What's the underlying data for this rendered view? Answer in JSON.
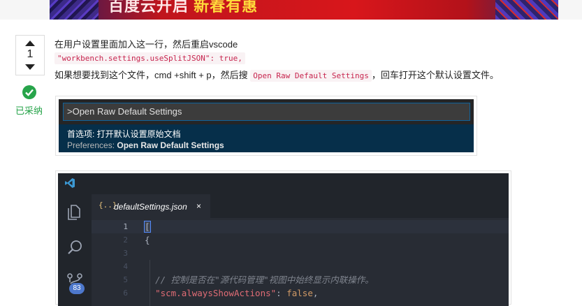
{
  "banner": {
    "text_white": "百度云开启",
    "text_yellow": "新春有惠"
  },
  "vote": {
    "count": "1",
    "accepted_label": "已采纳"
  },
  "answer": {
    "line1": "在用户设置里面加入这一行，然后重启vscode",
    "code_line": "\"workbench.settings.useSplitJSON\": true,",
    "line3_prefix": "如果想要找到这个文件，cmd +shift + p，然后搜 ",
    "line3_code": "Open Raw Default Settings",
    "line3_suffix": "，回车打开这个默认设置文件。"
  },
  "palette": {
    "input_value": ">Open Raw Default Settings",
    "item_title": "首选项: 打开默认设置原始文档",
    "item_sub_prefix": "Preferences: ",
    "item_sub_bold": "Open Raw Default Settings"
  },
  "editor": {
    "tab_icon": "{..}",
    "tab_label": "defaultSettings.json",
    "tab_close": "×",
    "scm_badge": "83",
    "line_numbers": [
      "1",
      "2",
      "3",
      "4",
      "5",
      "6"
    ],
    "line1": "[",
    "line2": "{",
    "line5_comment": "// 控制是否在\"源代码管理\"视图中始终显示内联操作。",
    "line6_key": "\"scm.alwaysShowActions\"",
    "line6_rest_colon": ": ",
    "line6_value": "false",
    "line6_comma": ","
  },
  "icons": {
    "vote_up": "triangle-up-icon",
    "vote_down": "triangle-down-icon",
    "accepted": "check-circle-icon",
    "vscode_logo": "vscode-logo-icon",
    "explorer": "files-icon",
    "search": "search-icon",
    "scm": "source-control-icon"
  },
  "colors": {
    "accepted_green": "#27a44a",
    "inline_code": "#c7254e",
    "editor_bg": "#282c34",
    "badge": "#4d78cc"
  }
}
